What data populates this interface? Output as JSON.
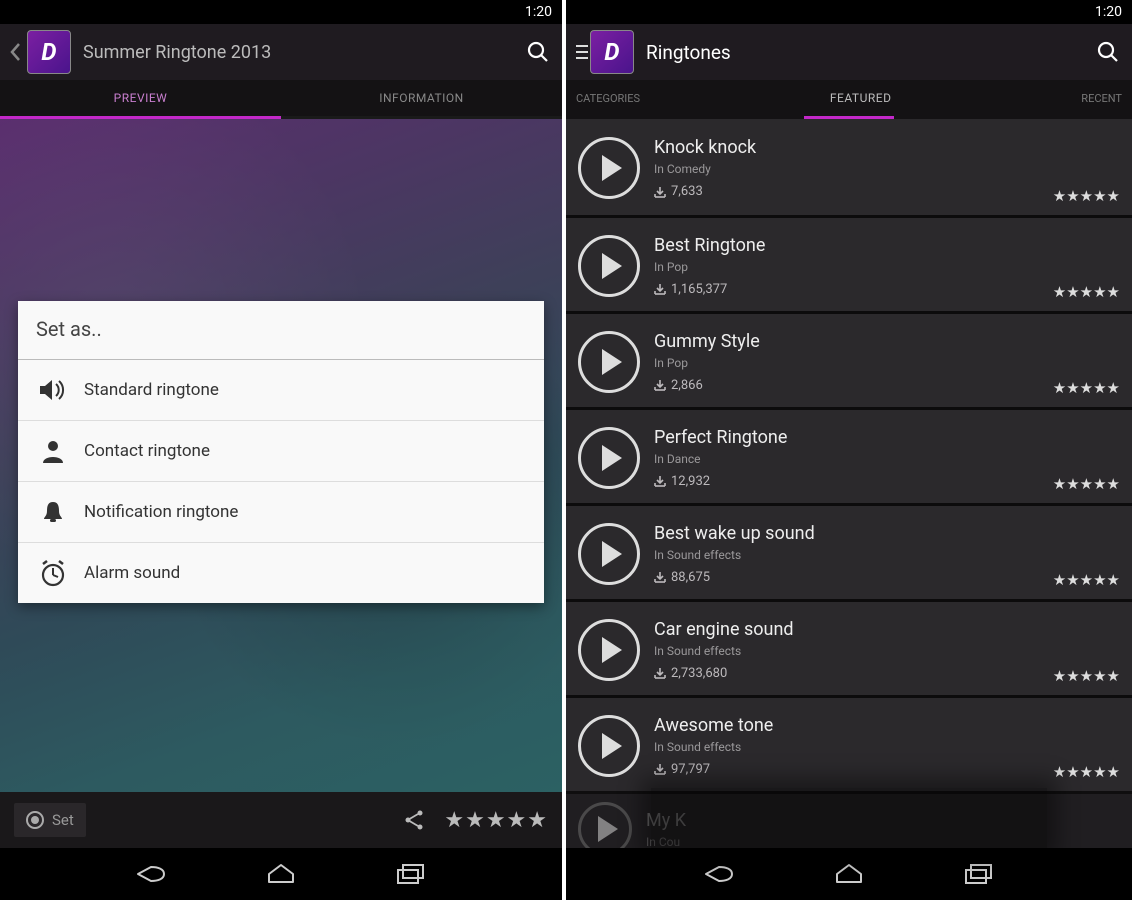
{
  "status": {
    "time": "1:20"
  },
  "left": {
    "title": "Summer Ringtone 2013",
    "tabs": {
      "preview": "PREVIEW",
      "information": "INFORMATION"
    },
    "dialog": {
      "title": "Set as..",
      "items": [
        {
          "label": "Standard ringtone",
          "icon": "volume-icon"
        },
        {
          "label": "Contact ringtone",
          "icon": "person-icon"
        },
        {
          "label": "Notification ringtone",
          "icon": "bell-icon"
        },
        {
          "label": "Alarm sound",
          "icon": "alarm-icon"
        }
      ]
    },
    "footer": {
      "set": "Set",
      "stars": "★★★★★"
    }
  },
  "right": {
    "title": "Ringtones",
    "tabs": {
      "categories": "CATEGORIES",
      "featured": "FEATURED",
      "recent": "RECENT"
    },
    "rows": [
      {
        "title": "Knock knock",
        "sub": "In Comedy",
        "dl": "7,633",
        "stars": "★★★★★"
      },
      {
        "title": "Best Ringtone",
        "sub": "In Pop",
        "dl": "1,165,377",
        "stars": "★★★★★"
      },
      {
        "title": "Gummy Style",
        "sub": "In Pop",
        "dl": "2,866",
        "stars": "★★★★★"
      },
      {
        "title": "Perfect Ringtone",
        "sub": "In Dance",
        "dl": "12,932",
        "stars": "★★★★★"
      },
      {
        "title": "Best wake up sound",
        "sub": "In Sound effects",
        "dl": "88,675",
        "stars": "★★★★★"
      },
      {
        "title": "Car engine sound",
        "sub": "In Sound effects",
        "dl": "2,733,680",
        "stars": "★★★★★"
      },
      {
        "title": "Awesome tone",
        "sub": "In Sound effects",
        "dl": "97,797",
        "stars": "★★★★★"
      },
      {
        "title": "My K",
        "sub": "In Cou",
        "dl": "",
        "stars": ""
      }
    ]
  }
}
